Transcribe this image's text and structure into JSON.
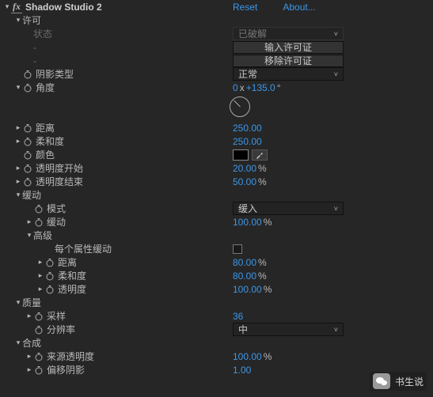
{
  "header": {
    "name": "Shadow Studio 2",
    "reset": "Reset",
    "about": "About..."
  },
  "license": {
    "group": "许可",
    "stateLabel": "状态",
    "stateValue": "已破解",
    "dash": "-",
    "enterBtn": "输入许可证",
    "removeBtn": "移除许可证"
  },
  "shadowType": {
    "label": "阴影类型",
    "value": "正常"
  },
  "angle": {
    "label": "角度",
    "rev": "0",
    "sep": "x",
    "deg": "+135.0",
    "unit": "°"
  },
  "distance": {
    "label": "距离",
    "value": "250.00"
  },
  "softness": {
    "label": "柔和度",
    "value": "250.00"
  },
  "color": {
    "label": "颜色",
    "hex": "#000000"
  },
  "opacityStart": {
    "label": "透明度开始",
    "value": "20.00",
    "unit": "%"
  },
  "opacityEnd": {
    "label": "透明度结束",
    "value": "50.00",
    "unit": "%"
  },
  "easing": {
    "group": "缓动",
    "mode": {
      "label": "模式",
      "value": "缓入"
    },
    "amount": {
      "label": "缓动",
      "value": "100.00",
      "unit": "%"
    }
  },
  "advanced": {
    "group": "高级",
    "perProp": "每个属性缓动",
    "distance": {
      "label": "距离",
      "value": "80.00",
      "unit": "%"
    },
    "softness": {
      "label": "柔和度",
      "value": "80.00",
      "unit": "%"
    },
    "opacity": {
      "label": "透明度",
      "value": "100.00",
      "unit": "%"
    }
  },
  "quality": {
    "group": "质量",
    "samples": {
      "label": "采样",
      "value": "36"
    },
    "resolution": {
      "label": "分辨率",
      "value": "中"
    }
  },
  "composite": {
    "group": "合成",
    "sourceOpacity": {
      "label": "来源透明度",
      "value": "100.00",
      "unit": "%"
    },
    "offsetShadow": {
      "label": "偏移阴影",
      "value": "1.00"
    }
  },
  "watermark": "书生说"
}
